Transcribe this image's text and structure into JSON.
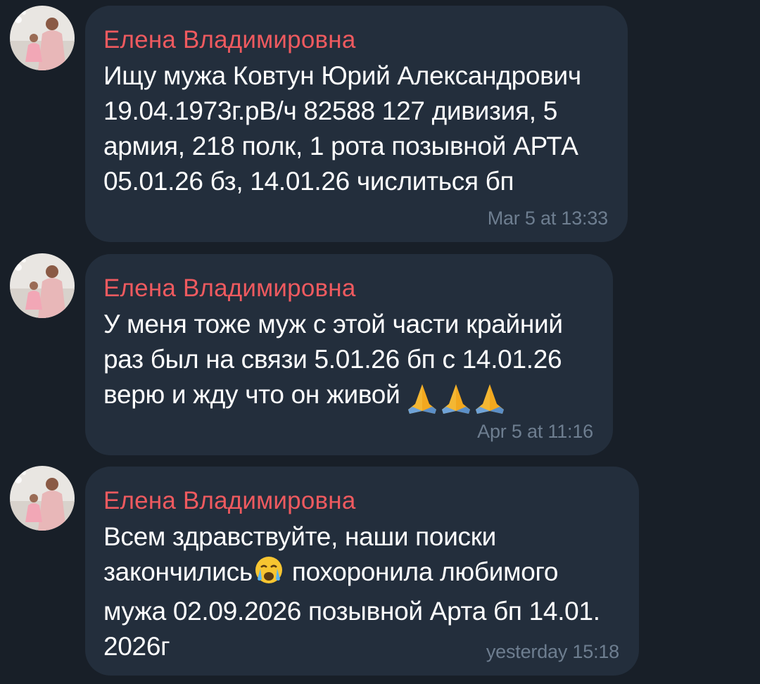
{
  "messages": [
    {
      "sender": "Елена Владимировна",
      "lines": [
        "Ищу мужа Ковтун Юрий Александрович",
        "19.04.1973г.рВ/ч 82588 127 дивизия, 5",
        "армия, 218 полк, 1 рота позывной АРТА",
        "05.01.26 бз, 14.01.26 числиться бп"
      ],
      "time": "Mar 5 at 13:33"
    },
    {
      "sender": "Елена Владимировна",
      "lines": [
        "У меня тоже муж с этой части крайний",
        "раз был на связи 5.01.26 бп с 14.01.26",
        "верю и жду что он живой"
      ],
      "emoji": [
        "folded-hands-emoji",
        "folded-hands-emoji",
        "folded-hands-emoji"
      ],
      "time": "Apr 5 at 11:16"
    },
    {
      "sender": "Елена Владимировна",
      "lines": [
        "Всем здравствуйте, наши поиски",
        "закончились",
        "похоронила любимого",
        "мужа 02.09.2026 позывной Арта бп 14.01.",
        "2026г"
      ],
      "emoji": [
        "crying-face-emoji"
      ],
      "time": "yesterday 15:18"
    }
  ],
  "colors": {
    "background": "#181f28",
    "bubble": "#232e3c",
    "sender_name": "#ef5a5f",
    "message_text": "#ffffff",
    "timestamp": "#6e7e90"
  }
}
